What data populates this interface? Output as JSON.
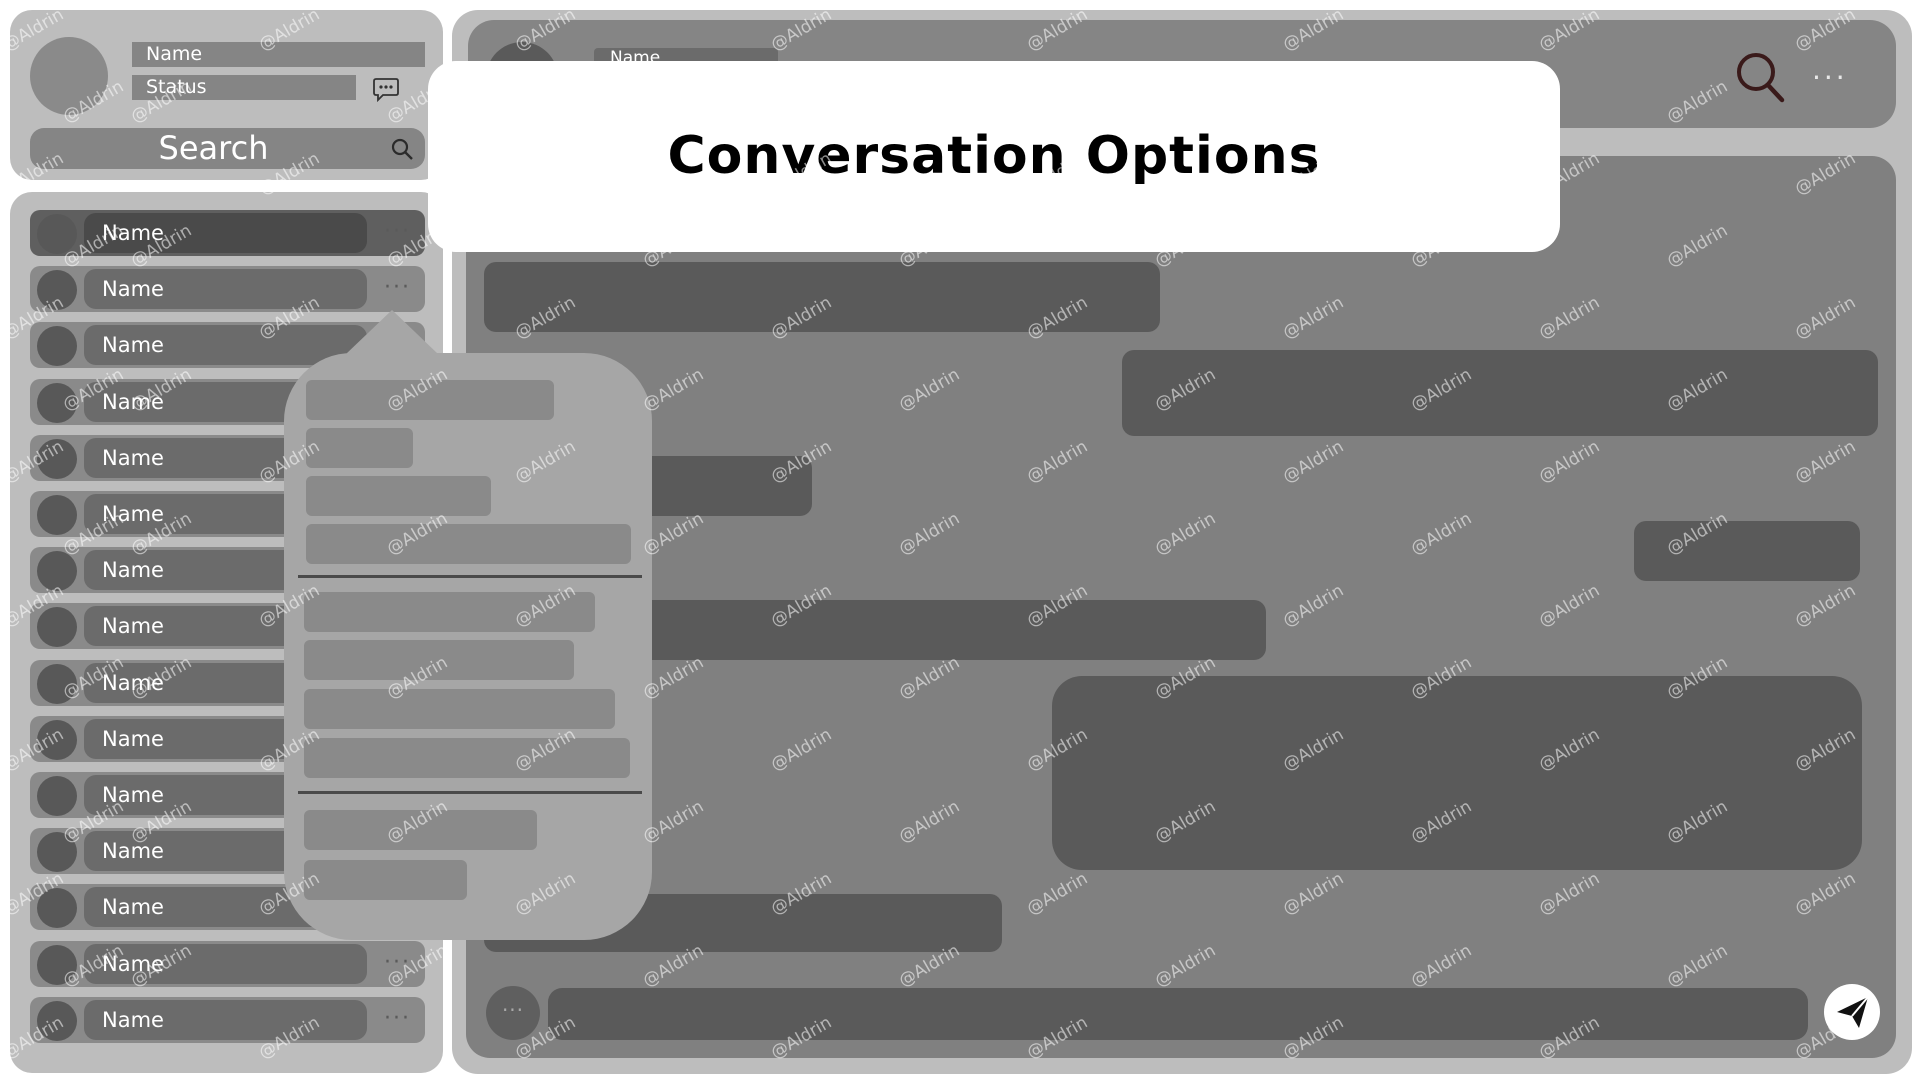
{
  "profile": {
    "name_label": "Name",
    "status_label": "Status",
    "chat_icon": "chat-bubble-icon"
  },
  "search": {
    "label": "Search",
    "icon": "search-icon"
  },
  "contacts": [
    {
      "name": "Name",
      "selected": true
    },
    {
      "name": "Name"
    },
    {
      "name": "Name"
    },
    {
      "name": "Name"
    },
    {
      "name": "Name"
    },
    {
      "name": "Name"
    },
    {
      "name": "Name"
    },
    {
      "name": "Name"
    },
    {
      "name": "Name"
    },
    {
      "name": "Name"
    },
    {
      "name": "Name"
    },
    {
      "name": "Name"
    },
    {
      "name": "Name"
    },
    {
      "name": "Name"
    },
    {
      "name": "Name"
    }
  ],
  "contact_more_label": "···",
  "header": {
    "name_label": "Name",
    "search_icon": "search-icon",
    "more_icon": "more-horizontal-icon",
    "more_label": "···"
  },
  "composer": {
    "more_label": "···",
    "send_icon": "paper-plane-icon"
  },
  "dialog": {
    "title": "Conversation  Options"
  },
  "context_menu": {
    "groups": [
      {
        "items": 4
      },
      {
        "items": 4
      },
      {
        "items": 2
      }
    ]
  },
  "watermark": "@Aldrin",
  "colors": {
    "panel": "#bdbdbd",
    "chat_body": "#808080",
    "message": "#5a5a5a",
    "popover": "#a6a6a6",
    "card": "#ffffff"
  }
}
